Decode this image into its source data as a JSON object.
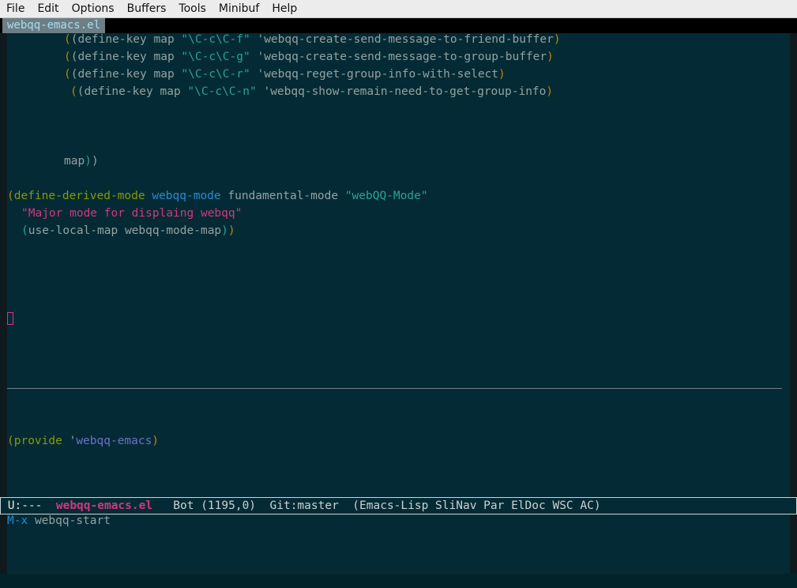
{
  "menu": [
    "File",
    "Edit",
    "Options",
    "Buffers",
    "Tools",
    "Minibuf",
    "Help"
  ],
  "tab": {
    "label": "webqq-emacs.el"
  },
  "code": {
    "line1": {
      "pre": "(define-key map ",
      "key": "\"\\C-c\\C-f\"",
      "sym": " 'webqq-create-send-message-to-friend-buffer"
    },
    "line2": {
      "pre": "(define-key map ",
      "key": "\"\\C-c\\C-g\"",
      "sym": " 'webqq-create-send-message-to-group-buffer"
    },
    "line3": {
      "pre": "(define-key map ",
      "key": "\"\\C-c\\C-r\"",
      "sym": " 'webqq-reget-group-info-with-select"
    },
    "line4": {
      "pre": "(define-key map ",
      "key": "\"\\C-c\\C-n\"",
      "sym": " 'webqq-show-remain-need-to-get-group-info"
    },
    "map_close": "map",
    "derived": {
      "kw": "define-derived-mode",
      "name": "webqq-mode",
      "parent": "fundamental-mode",
      "str": "\"webQQ-Mode\""
    },
    "docstring": "\"Major mode for displaing webqq\"",
    "use_local": "use-local-map webqq-mode-map",
    "provide": {
      "kw": "provide",
      "quote": "'",
      "sym": "webqq-emacs"
    }
  },
  "modeline": {
    "state": "U:---",
    "buffer": "webqq-emacs.el",
    "position": "Bot (1195,0)",
    "vc": "Git:master",
    "modes": "(Emacs-Lisp SliNav Par ElDoc WSC AC)"
  },
  "minibuffer": {
    "prompt": "M-x",
    "input": "webqq-start"
  }
}
